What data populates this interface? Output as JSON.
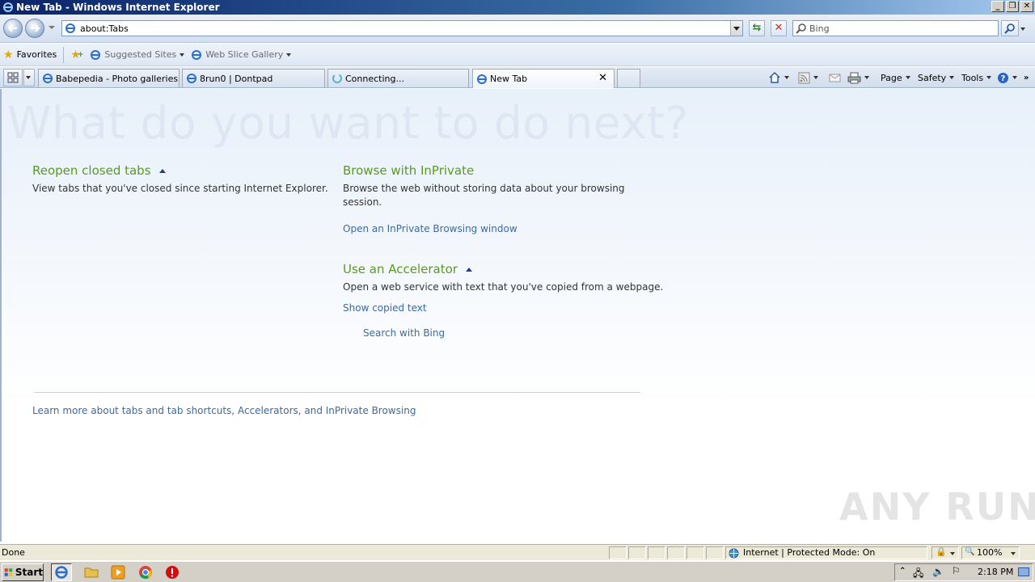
{
  "window": {
    "title": "New Tab - Windows Internet Explorer",
    "buttons": [
      "minimize",
      "restore",
      "close"
    ]
  },
  "address_bar": {
    "url": "about:Tabs",
    "search_placeholder": "Bing"
  },
  "favorites_bar": {
    "favorites_label": "Favorites",
    "suggested_sites_label": "Suggested Sites",
    "web_slice_label": "Web Slice Gallery"
  },
  "tabs": [
    {
      "label": "Babepedia - Photo galleries ..."
    },
    {
      "label": "8run0 | Dontpad"
    },
    {
      "label": "Connecting..."
    },
    {
      "label": "New Tab",
      "active": true
    }
  ],
  "command_bar": {
    "page_label": "Page",
    "safety_label": "Safety",
    "tools_label": "Tools"
  },
  "content": {
    "headline": "What do you want to do next?",
    "reopen_title": "Reopen closed tabs",
    "reopen_text": "View tabs that you've closed since starting Internet Explorer.",
    "inprivate_title": "Browse with InPrivate",
    "inprivate_text": "Browse the web without storing data about your browsing session.",
    "inprivate_link": "Open an InPrivate Browsing window",
    "accelerator_title": "Use an Accelerator",
    "accelerator_text": "Open a web service with text that you've copied from a webpage.",
    "show_copied_link": "Show copied text",
    "search_bing_link": "Search with Bing",
    "learn_more_link": "Learn more about tabs and tab shortcuts, Accelerators, and InPrivate Browsing"
  },
  "watermark": "ANY RUN",
  "status_bar": {
    "status": "Done",
    "zone": "Internet | Protected Mode: On",
    "zoom": "100%"
  },
  "taskbar": {
    "start_label": "Start",
    "clock": "2:18 PM"
  }
}
